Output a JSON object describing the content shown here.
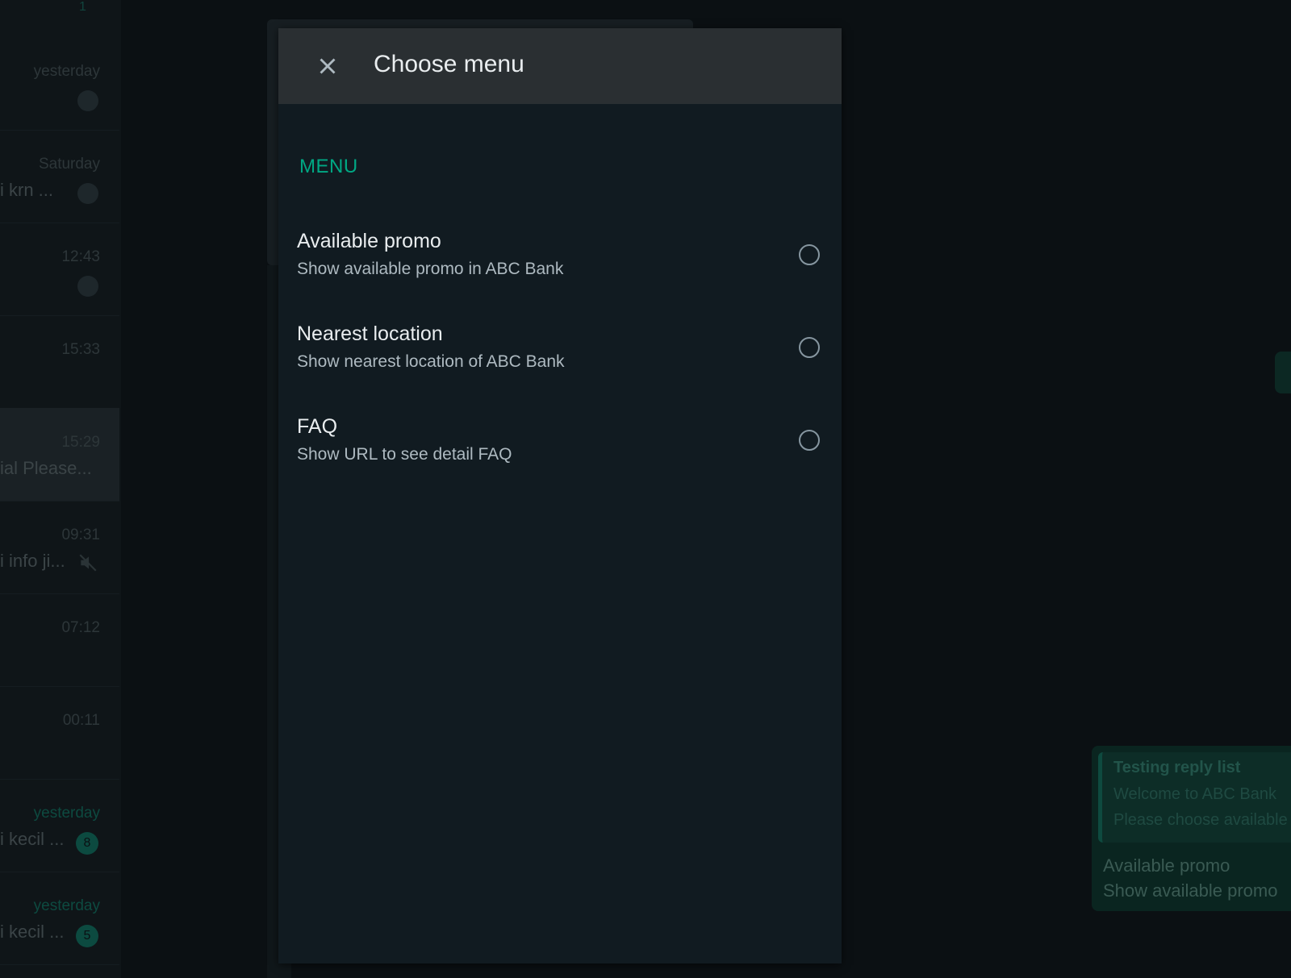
{
  "background": {
    "top_count": "1",
    "chats": [
      {
        "time": "yesterday",
        "preview": "",
        "status_icon": "check-icon"
      },
      {
        "time": "Saturday",
        "preview": "i krn ...",
        "status_icon": "check-icon"
      },
      {
        "time": "12:43",
        "preview": "",
        "status_icon": "check-icon"
      },
      {
        "time": "15:33",
        "preview": ""
      },
      {
        "time": "15:29",
        "preview": "ial Please...",
        "selected": true
      },
      {
        "time": "09:31",
        "preview": "i info ji...",
        "status_icon": "muted-icon"
      },
      {
        "time": "07:12",
        "preview": ""
      },
      {
        "time": "00:11",
        "preview": ""
      },
      {
        "time": "yesterday",
        "preview": "i kecil ...",
        "badge": "8",
        "unread": true
      },
      {
        "time": "yesterday",
        "preview": "i kecil ...",
        "badge": "5",
        "unread": true
      }
    ],
    "bubble": {
      "quote_title": "Testing reply list",
      "quote_line1": "Welcome to ABC Bank",
      "quote_line2": "Please choose available",
      "body_line1": "Available promo",
      "body_line2": "Show available promo"
    }
  },
  "modal": {
    "title": "Choose menu",
    "section": "MENU",
    "options": [
      {
        "title": "Available promo",
        "description": "Show available promo in ABC Bank",
        "selected": false
      },
      {
        "title": "Nearest location",
        "description": "Show nearest location of ABC Bank",
        "selected": false
      },
      {
        "title": "FAQ",
        "description": "Show URL to see detail FAQ",
        "selected": false
      }
    ]
  },
  "colors": {
    "accent": "#00a884",
    "modal_bg": "#111b21",
    "header_bg": "#2a2f32",
    "text_primary": "#e9edef",
    "text_secondary": "#aebac1"
  }
}
